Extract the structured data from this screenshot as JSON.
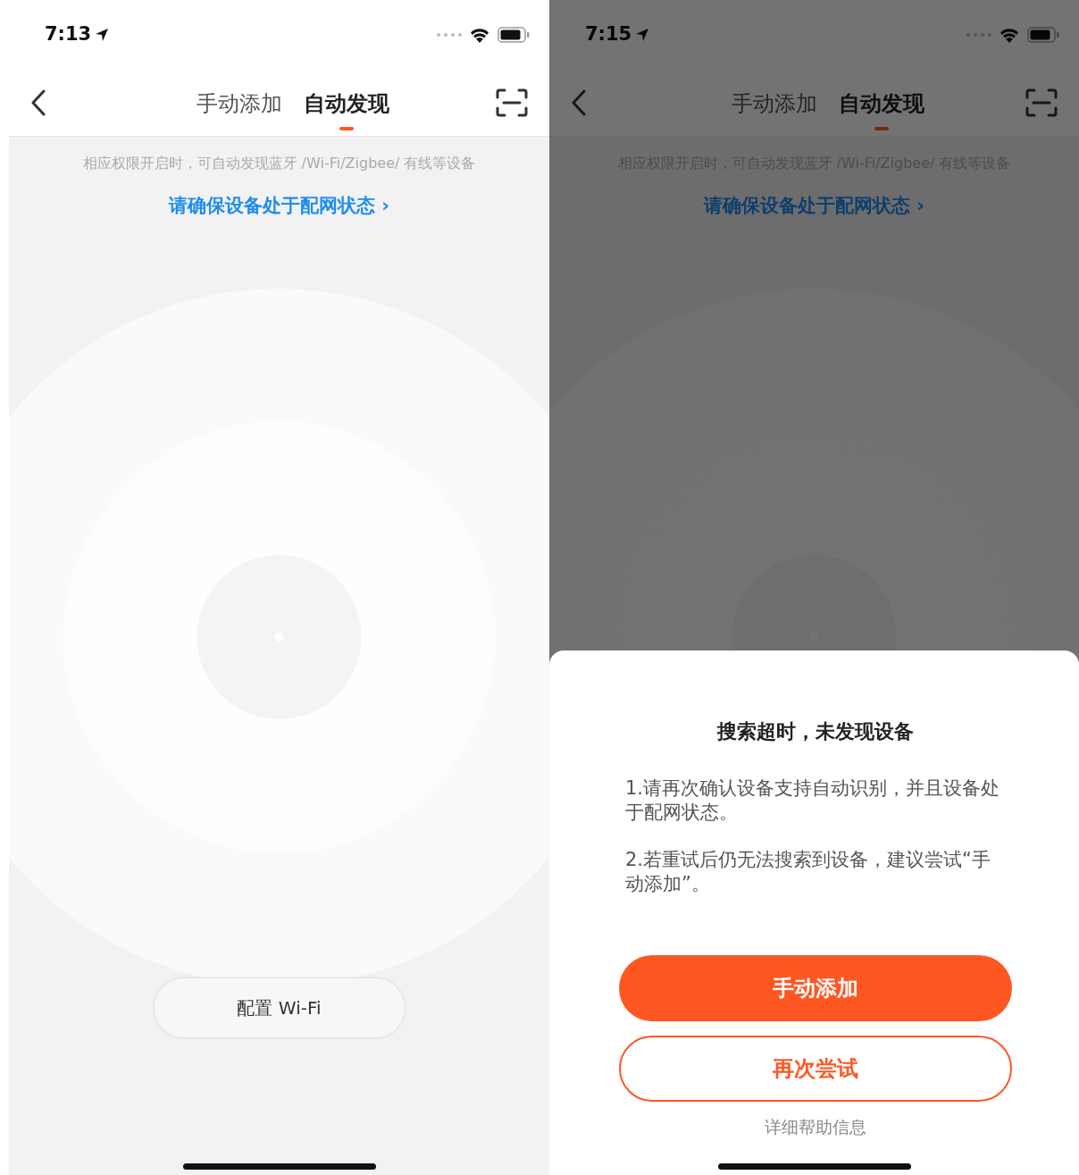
{
  "screens": [
    {
      "status_bar": {
        "time": "7:13"
      },
      "tabs": [
        {
          "label": "手动添加",
          "selected": false
        },
        {
          "label": "自动发现",
          "selected": true
        }
      ],
      "hint": "相应权限开启时，可自动发现蓝牙 /Wi-Fi/Zigbee/ 有线等设备",
      "link": "请确保设备处于配网状态 ›",
      "wifi_button": "配置 Wi-Fi"
    },
    {
      "status_bar": {
        "time": "7:15"
      },
      "tabs": [
        {
          "label": "手动添加",
          "selected": false
        },
        {
          "label": "自动发现",
          "selected": true
        }
      ],
      "hint": "相应权限开启时，可自动发现蓝牙 /Wi-Fi/Zigbee/ 有线等设备",
      "link": "请确保设备处于配网状态 ›",
      "dialog": {
        "title": "搜索超时，未发现设备",
        "items": [
          "1.请再次确认设备支持自动识别，并且设备处于配网状态。",
          "2.若重试后仍无法搜索到设备，建议尝试“手动添加”。"
        ],
        "buttons": [
          {
            "label": "手动添加",
            "kind": "primary"
          },
          {
            "label": "再次尝试",
            "kind": "outline"
          }
        ],
        "help": "详细帮助信息"
      }
    }
  ]
}
